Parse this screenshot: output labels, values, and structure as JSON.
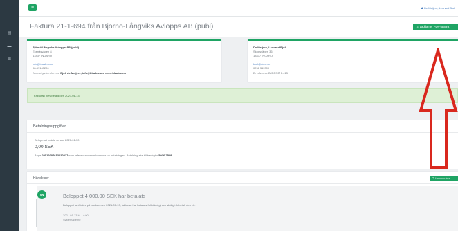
{
  "sidebar": {
    "items": [
      {
        "icon": "bank-icon",
        "glyph": "▤"
      },
      {
        "icon": "card-icon",
        "glyph": "▬"
      },
      {
        "icon": "chart-icon",
        "glyph": "▥"
      }
    ]
  },
  "topbar": {
    "menu_glyph": "≡",
    "user_label": "De Meijere, Leonard Bjoll"
  },
  "page": {
    "title": "Faktura 21-1-694 från Björnö-Långviks Avlopps AB (publ)",
    "download_button": "Ladda ner PDF-faktura"
  },
  "seller": {
    "name": "Björnö-Långviks Avlopps AB (publ)",
    "address": "Ekenäsvägen 8",
    "postal": "13437 INGARÖ",
    "email": "info@blaab.com",
    "phone": "08-57143200",
    "ref_label": "Ansvarig/vår referens:",
    "ref_value": "Bjoll de Meijere, info@blaab.com, www.blaab.com"
  },
  "buyer": {
    "name": "De Meijere, Leonard Bjoll",
    "address": "Skogsvägen 36",
    "postal": "13437 INGARÖ",
    "email": "bjoll@dem.se",
    "phone": "0766 511300",
    "extra": "Er referens: BJÖRNÖ 1:413"
  },
  "alert": {
    "text": "Fakturan blev betald den 2021-01-13."
  },
  "payment": {
    "heading": "Betalningsuppgifter",
    "due_label": "Belopp att betala senast 2021-01-30",
    "amount": "0,00 SEK",
    "ocr_prefix": "Ange",
    "ocr_value": "20512007613020517",
    "ocr_mid": "som referensnummer/nummer på betalningen. Betalning ske till bankgiro",
    "bankgiro": "5036-7509"
  },
  "events": {
    "heading": "Händelser",
    "comment_button": "Kommentera",
    "item": {
      "avatar": "SN",
      "title": "Beloppet 4 000,00 SEK har betalats",
      "description": "Beloppet fanfördes på banken den 2021-01-13, fakturan har betalats fullständigt och slutligt. Inbetalt den ett.",
      "date": "2021-01-13 kl. 14:00",
      "author": "Systemagente"
    }
  },
  "colors": {
    "sidebar": "#2c3942",
    "accent": "#1fa464",
    "alert_bg": "#def0d6",
    "arrow": "#d9281e"
  }
}
